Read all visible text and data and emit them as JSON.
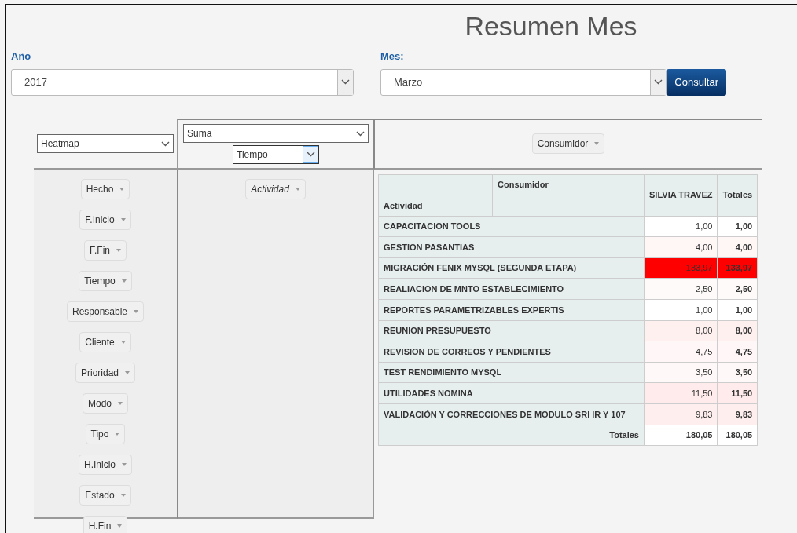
{
  "title": "Resumen Mes",
  "year": {
    "label": "Año",
    "value": "2017"
  },
  "month": {
    "label": "Mes:",
    "value": "Marzo"
  },
  "submit_button": "Consultar",
  "renderer": {
    "value": "Heatmap"
  },
  "aggregator": {
    "value": "Suma",
    "attribute": "Tiempo"
  },
  "column_field": "Consumidor",
  "row_field": "Actividad",
  "unused_fields": [
    "Hecho",
    "F.Inicio",
    "F.Fin",
    "Tiempo",
    "Responsable",
    "Cliente",
    "Prioridad",
    "Modo",
    "Tipo",
    "H.Inicio",
    "Estado",
    "H.Fin"
  ],
  "table": {
    "col_axis": "Consumidor",
    "row_axis": "Actividad",
    "columns": [
      "SILVIA TRAVEZ",
      "Totales"
    ],
    "rows": [
      {
        "label": "CAPACITACION TOOLS",
        "value": "1,00",
        "total": "1,00",
        "color": "#ffffff"
      },
      {
        "label": "GESTION PASANTIAS",
        "value": "4,00",
        "total": "4,00",
        "color": "#fff6f6"
      },
      {
        "label": "MIGRACIÓN FENIX MYSQL (SEGUNDA ETAPA)",
        "value": "133,97",
        "total": "133,97",
        "color": "#ff0000"
      },
      {
        "label": "REALIACION DE MNTO ESTABLECIMIENTO",
        "value": "2,50",
        "total": "2,50",
        "color": "#fffafa"
      },
      {
        "label": "REPORTES PARAMETRIZABLES EXPERTIS",
        "value": "1,00",
        "total": "1,00",
        "color": "#ffffff"
      },
      {
        "label": "REUNION PRESUPUESTO",
        "value": "8,00",
        "total": "8,00",
        "color": "#fff0f0"
      },
      {
        "label": "REVISION DE CORREOS Y PENDIENTES",
        "value": "4,75",
        "total": "4,75",
        "color": "#fff7f7"
      },
      {
        "label": "TEST RENDIMIENTO MYSQL",
        "value": "3,50",
        "total": "3,50",
        "color": "#fff8f8"
      },
      {
        "label": "UTILIDADES NOMINA",
        "value": "11,50",
        "total": "11,50",
        "color": "#ffebeb"
      },
      {
        "label": "VALIDACIÓN Y CORRECCIONES DE MODULO SRI IR Y 107",
        "value": "9,83",
        "total": "9,83",
        "color": "#ffeeee"
      }
    ],
    "totals_label": "Totales",
    "totals": [
      "180,05",
      "180,05"
    ]
  }
}
